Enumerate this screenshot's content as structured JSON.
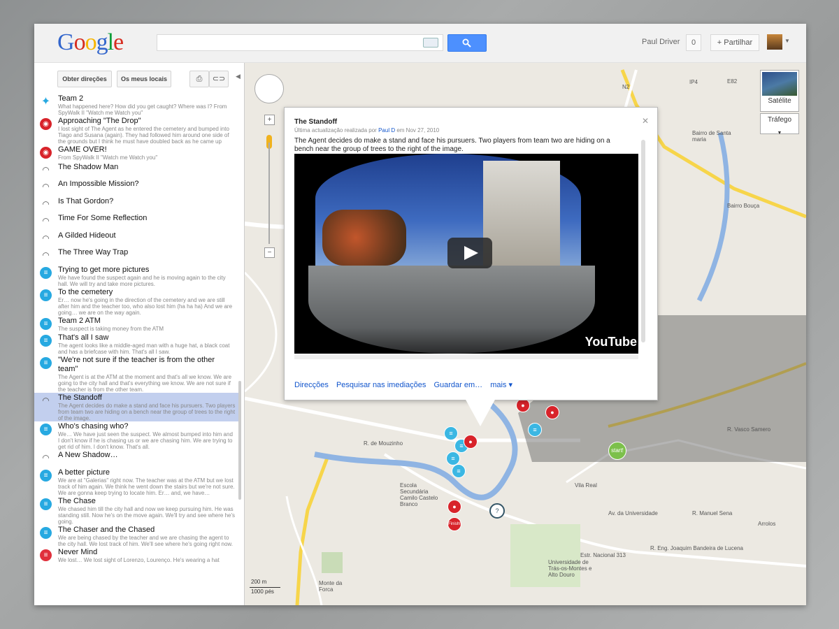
{
  "header": {
    "logo": [
      "G",
      "o",
      "o",
      "g",
      "l",
      "e"
    ],
    "logo_colors": [
      "#3366cc",
      "#d62d20",
      "#f7b500",
      "#3366cc",
      "#0b9d39",
      "#d62d20"
    ],
    "user_name": "Paul Driver",
    "share_count": "0",
    "share_label": "Partilhar",
    "search_placeholder": ""
  },
  "sidebar": {
    "get_directions": "Obter direções",
    "my_places": "Os meus locais",
    "items": [
      {
        "icon": "walk",
        "title": "Team 2",
        "desc": "What happened here? How did you get caught? Where was I? From SpyWalk II \"Watch me Watch you\"",
        "selected": false
      },
      {
        "icon": "red",
        "title": "Approaching \"The Drop\"",
        "desc": "I lost sight of The Agent as he entered the cemetery and bumped into Tiago and Susana (again). They had followed him around one side of the grounds but I think he must have doubled back as he came up",
        "selected": false
      },
      {
        "icon": "red",
        "title": "GAME OVER!",
        "desc": "From SpyWalk II \"Watch me Watch you\"",
        "selected": false
      },
      {
        "icon": "hat",
        "title": "The Shadow Man",
        "desc": "",
        "selected": false
      },
      {
        "icon": "hat",
        "title": "An Impossible Mission?",
        "desc": "",
        "selected": false
      },
      {
        "icon": "hat",
        "title": "Is That Gordon?",
        "desc": "",
        "selected": false
      },
      {
        "icon": "hat",
        "title": "Time For Some Reflection",
        "desc": "",
        "selected": false
      },
      {
        "icon": "hat",
        "title": "A Gilded Hideout",
        "desc": "",
        "selected": false
      },
      {
        "icon": "hat",
        "title": "The Three Way Trap",
        "desc": "",
        "selected": false
      },
      {
        "icon": "chat",
        "title": "Trying to get more pictures",
        "desc": "We have found the suspect again and he is moving again to the city hall. We will try and take more pictures.",
        "selected": false
      },
      {
        "icon": "chat",
        "title": "To the cemetery",
        "desc": "Er… now he's going in the direction of the cemetery and we are still after him and the teacher too, who also lost him (ha ha ha) And we are going… we are on the way again.",
        "selected": false
      },
      {
        "icon": "chat",
        "title": "Team 2 ATM",
        "desc": "The suspect is taking money from the ATM",
        "selected": false
      },
      {
        "icon": "chat",
        "title": "That's all I saw",
        "desc": "The agent looks like a middle-aged man with a huge hat, a black coat and has a briefcase with him. That's all I saw.",
        "selected": false
      },
      {
        "icon": "chat",
        "title": "\"We're not sure if the teacher is from the other team\"",
        "desc": "The Agent is at the ATM at the moment and that's all we know. We are going to the city hall and that's everything we know. We are not sure if the teacher is from the other team.",
        "selected": false
      },
      {
        "icon": "hat",
        "title": "The Standoff",
        "desc": "The Agent decides do make a stand and face his pursuers. Two players from team two are hiding on a bench near the group of trees to the right of the image.",
        "selected": true
      },
      {
        "icon": "chat",
        "title": "Who's chasing who?",
        "desc": "We… We have just seen the suspect. We almost bumped into him and I don't know if he is chasing us or we are chasing him. We are trying to get rid of him. I don't know. That's all.",
        "selected": false
      },
      {
        "icon": "hat",
        "title": "A New Shadow…",
        "desc": "",
        "selected": false
      },
      {
        "icon": "chat",
        "title": "A better picture",
        "desc": "We are at \"Galerias\" right now. The teacher was at the ATM but we lost track of him again. We think he went down the stairs but we're not sure. We are gonna keep trying to locate him. Er… and, we have…",
        "selected": false
      },
      {
        "icon": "chat",
        "title": "The Chase",
        "desc": "We chased him till the city hall and now we keep pursuing him. He was standing still. Now he's on the move again. We'll try and see where he's going.",
        "selected": false
      },
      {
        "icon": "chat",
        "title": "The Chaser and the Chased",
        "desc": "We are being chased by the teacher and we are chasing the agent to the city hall. We lost track of him. We'll see where he's going right now.",
        "selected": false
      },
      {
        "icon": "redchat",
        "title": "Never Mind",
        "desc": "We lost… We lost sight of Lorenzo, Lourenço. He's wearing a hat",
        "selected": false
      }
    ]
  },
  "map": {
    "satellite": "Satélite",
    "traffic": "Tráfego",
    "labels": [
      {
        "text": "N2"
      },
      {
        "text": "IP4"
      },
      {
        "text": "E82"
      },
      {
        "text": "Bairro de Santa maria"
      },
      {
        "text": "Bairro Bouça"
      },
      {
        "text": "Vila Real"
      },
      {
        "text": "Arrolos"
      },
      {
        "text": "Escola Secundária Camilo Castelo Branco"
      },
      {
        "text": "Universidade de Trás-os-Montes e Alto Douro"
      },
      {
        "text": "Monte da Forca"
      },
      {
        "text": "R. de Mouzinho"
      },
      {
        "text": "R. Manuel Sena"
      },
      {
        "text": "Estr. Nacional 313"
      },
      {
        "text": "R. Eng. Joaquim Bandeira de Lucena"
      },
      {
        "text": "R. Vasco Samero"
      },
      {
        "text": "Av. da Universidade"
      },
      {
        "text": "Universidade de Trás-os-Montes"
      }
    ],
    "scale_m": "200 m",
    "scale_ft": "1000 pés",
    "start_label": "start!",
    "finish_label": "Finish!"
  },
  "infowindow": {
    "title": "The Standoff",
    "updated_prefix": "Última actualização realizada por",
    "updated_by": "Paul D",
    "updated_on": "em Nov 27, 2010",
    "description": "The Agent decides do make a stand and face his pursuers. Two players from team two are hiding on a bench near the group of trees to the right of the image.",
    "video_brand": "YouTube",
    "links": [
      "Direcções",
      "Pesquisar nas imediações",
      "Guardar em…",
      "mais ▾"
    ]
  }
}
